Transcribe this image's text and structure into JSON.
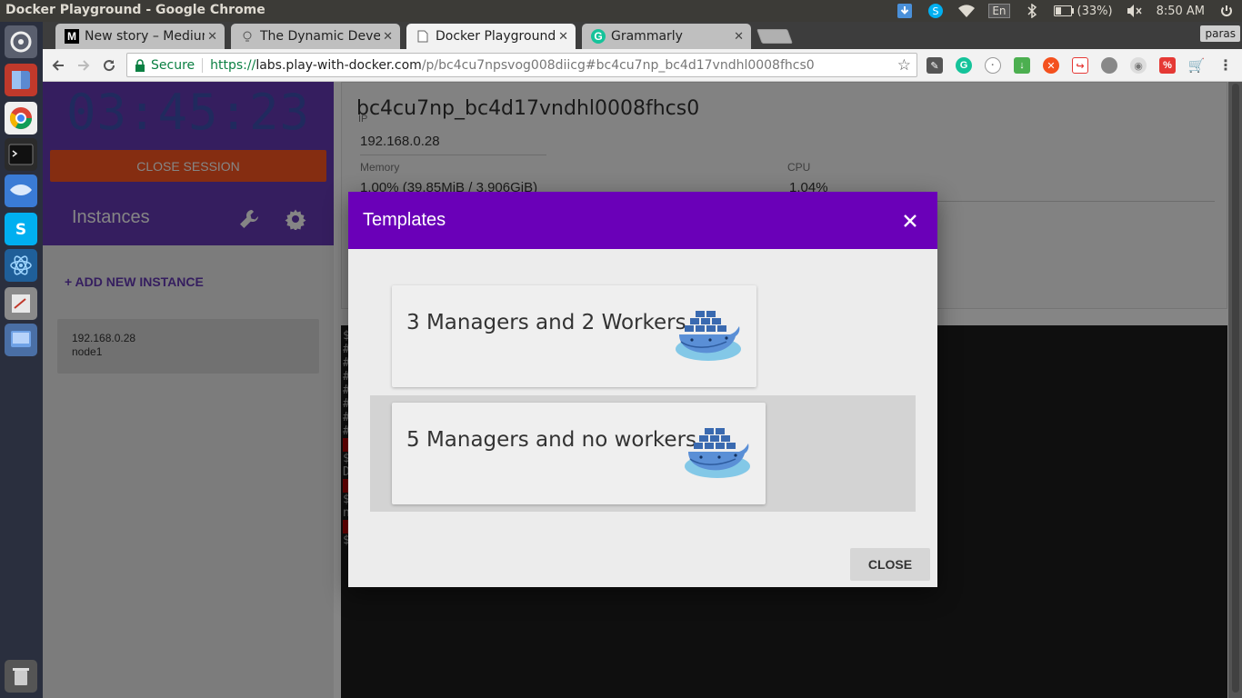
{
  "window": {
    "title": "Docker Playground - Google Chrome"
  },
  "tray": {
    "keyboard_layout": "En",
    "battery": "(33%)",
    "clock": "8:50 AM"
  },
  "launcher": {
    "items": [
      "dash-icon",
      "files-icon",
      "chrome-icon",
      "terminal-icon",
      "shutter-icon",
      "skype-icon",
      "atom-icon",
      "text-editor-icon",
      "virtualbox-icon",
      "trash-icon"
    ]
  },
  "tabs": [
    {
      "title": "New story – Medium",
      "favicon": "M",
      "active": false
    },
    {
      "title": "The Dynamic Developer",
      "favicon": "bulb",
      "active": false
    },
    {
      "title": "Docker Playground",
      "favicon": "doc",
      "active": true
    },
    {
      "title": "Grammarly",
      "favicon": "G",
      "active": false
    }
  ],
  "profile": "paras",
  "omnibox": {
    "secure_label": "Secure",
    "url_scheme": "https://",
    "url_host": "labs.play-with-docker.com",
    "url_path": "/p/bc4cu7npsvog008diicg#bc4cu7np_bc4d17vndhl0008fhcs0"
  },
  "sidebar": {
    "timer": "03:45:23",
    "close_session_label": "CLOSE SESSION",
    "instances_title": "Instances",
    "add_instance_label": "+ ADD NEW INSTANCE",
    "instance": {
      "ip": "192.168.0.28",
      "name": "node1"
    }
  },
  "details": {
    "node_title": "bc4cu7np_bc4d17vndhl0008fhcs0",
    "ip_label": "IP",
    "ip_value": "192.168.0.28",
    "memory_label": "Memory",
    "memory_value": "1.00% (39.85MiB / 3.906GiB)",
    "cpu_label": "CPU",
    "cpu_value": "1.04%"
  },
  "terminal": {
    "lines": [
      "$",
      "#",
      "#",
      "#",
      "#",
      "#",
      "#",
      "#",
      "",
      "$",
      "D",
      "",
      "$",
      "n",
      "",
      "$"
    ]
  },
  "modal": {
    "title": "Templates",
    "templates": [
      {
        "label": "3 Managers and 2 Workers",
        "selected": false
      },
      {
        "label": "5 Managers and no workers",
        "selected": true
      }
    ],
    "close_label": "CLOSE"
  },
  "colors": {
    "purple_header": "#673ab7",
    "modal_header": "#6a00b8",
    "close_session": "#ff5722",
    "timer": "#3f51b5"
  }
}
